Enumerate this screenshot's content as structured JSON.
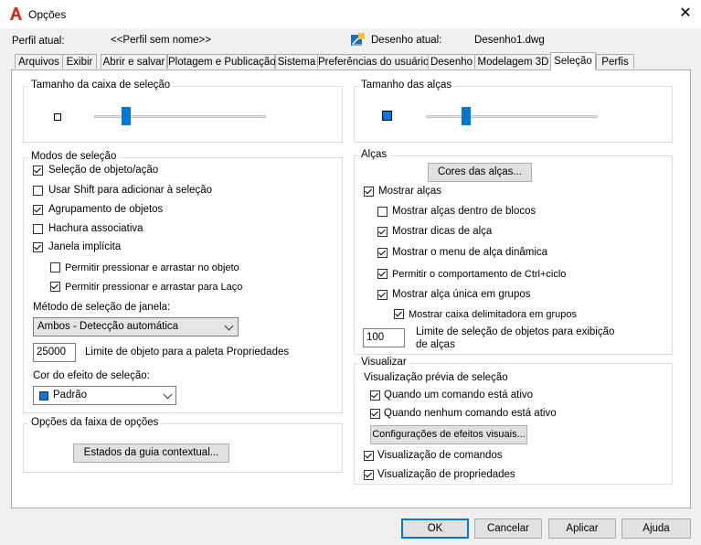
{
  "window": {
    "title": "Opções",
    "close_glyph": "✕"
  },
  "header": {
    "profile_label": "Perfil atual:",
    "profile_value": "<<Perfil sem nome>>",
    "drawing_label": "Desenho atual:",
    "drawing_value": "Desenho1.dwg"
  },
  "tabs": [
    {
      "label": "Arquivos"
    },
    {
      "label": "Exibir"
    },
    {
      "label": "Abrir e salvar"
    },
    {
      "label": "Plotagem e Publicação"
    },
    {
      "label": "Sistema"
    },
    {
      "label": "Preferências do usuário"
    },
    {
      "label": "Desenho"
    },
    {
      "label": "Modelagem 3D"
    },
    {
      "label": "Seleção"
    },
    {
      "label": "Perfis"
    }
  ],
  "active_tab": "Seleção",
  "pickbox": {
    "title": "Tamanho da caixa de seleção",
    "slider_fraction": 0.17
  },
  "gripsize": {
    "title": "Tamanho das alças",
    "slider_fraction": 0.22
  },
  "selection_modes": {
    "title": "Modos de seleção",
    "items": [
      {
        "label": "Seleção de objeto/ação",
        "checked": true
      },
      {
        "label": "Usar Shift para adicionar à seleção",
        "checked": false
      },
      {
        "label": "Agrupamento de objetos",
        "checked": true
      },
      {
        "label": "Hachura associativa",
        "checked": false
      },
      {
        "label": "Janela implícita",
        "checked": true
      },
      {
        "label": "Permitir pressionar e arrastar no objeto",
        "checked": false
      },
      {
        "label": "Permitir pressionar e arrastar para Laço",
        "checked": true
      }
    ],
    "window_method_label": "Método de seleção de janela:",
    "window_method_value": "Ambos - Detecção automática",
    "object_limit_value": "25000",
    "object_limit_label": "Limite de objeto para a paleta Propriedades",
    "effect_color_label": "Cor do efeito de seleção:",
    "effect_color_value": "Padrão",
    "effect_color_hex": "#0078d7"
  },
  "ribbon": {
    "title": "Opções da faixa de opções",
    "button": "Estados da guia contextual..."
  },
  "grips": {
    "title": "Alças",
    "colors_button": "Cores das alças...",
    "items": [
      {
        "label": "Mostrar alças",
        "checked": true
      },
      {
        "label": "Mostrar alças dentro de blocos",
        "checked": false
      },
      {
        "label": "Mostrar dicas de alça",
        "checked": true
      },
      {
        "label": "Mostrar o menu de alça dinâmica",
        "checked": true
      },
      {
        "label": "Permitir o comportamento de Ctrl+ciclo",
        "checked": true
      },
      {
        "label": "Mostrar alça única em grupos",
        "checked": true
      },
      {
        "label": "Mostrar caixa delimitadora em grupos",
        "checked": true
      }
    ],
    "limit_value": "100",
    "limit_label_1": "Limite de seleção de objetos para exibição",
    "limit_label_2": "de alças"
  },
  "preview": {
    "title": "Visualizar",
    "subtitle": "Visualização prévia de seleção",
    "items": [
      {
        "label": "Quando um comando está ativo",
        "checked": true
      },
      {
        "label": "Quando nenhum comando está ativo",
        "checked": true
      }
    ],
    "effects_button": "Configurações de efeitos visuais...",
    "items2": [
      {
        "label": "Visualização de comandos",
        "checked": true
      },
      {
        "label": "Visualização de propriedades",
        "checked": true
      }
    ]
  },
  "footer": {
    "ok": "OK",
    "cancel": "Cancelar",
    "apply": "Aplicar",
    "help": "Ajuda"
  }
}
